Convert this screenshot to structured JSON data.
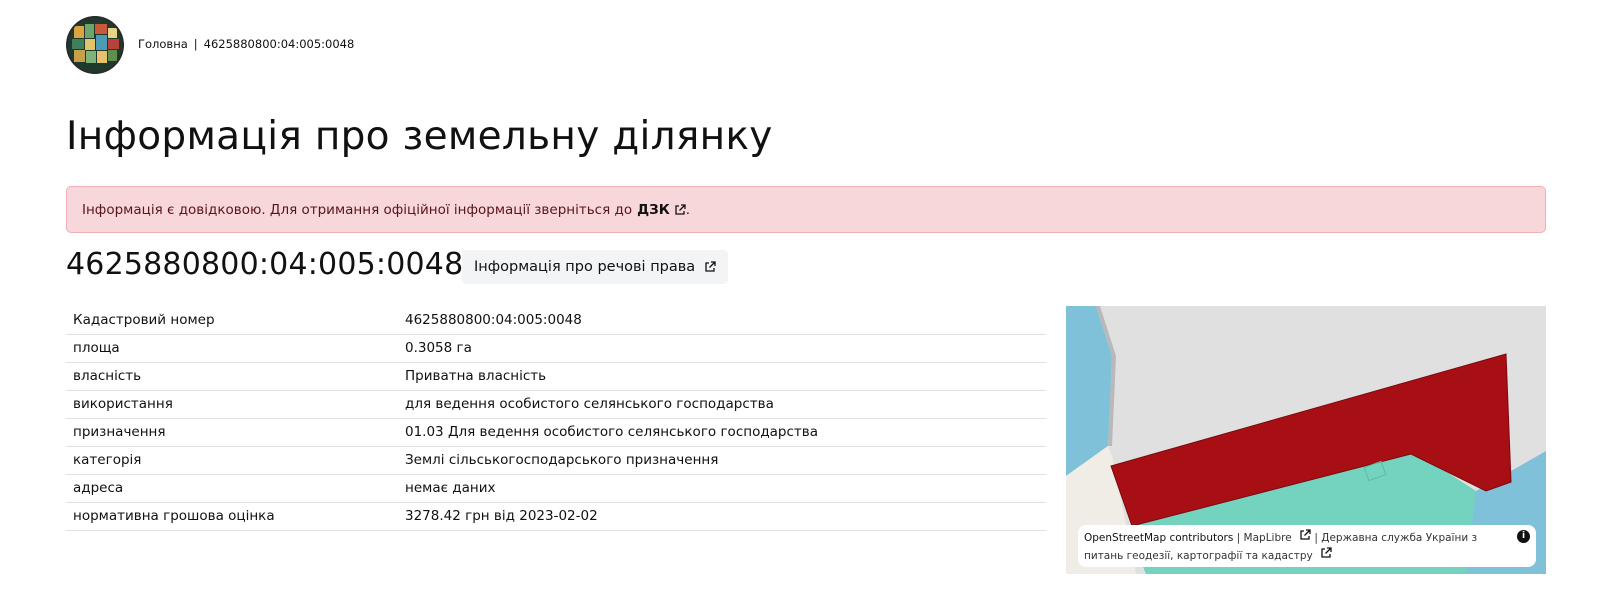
{
  "breadcrumb": {
    "home": "Головна",
    "separator": "|",
    "current": "4625880800:04:005:0048"
  },
  "page_title": "Інформація про земельну ділянку",
  "alert": {
    "text": "Інформація є довідковою. Для отримання офіційної інформації зверніться до",
    "link": "ДЗК",
    "tail": "."
  },
  "parcel": {
    "cadastral_number": "4625880800:04:005:0048",
    "rights_button": "Інформація про речові права"
  },
  "details": [
    {
      "key": "Кадастровий номер",
      "value": "4625880800:04:005:0048"
    },
    {
      "key": "площа",
      "value": "0.3058 га"
    },
    {
      "key": "власність",
      "value": "Приватна власність"
    },
    {
      "key": "використання",
      "value": "для ведення особистого селянського господарства"
    },
    {
      "key": "призначення",
      "value": "01.03 Для ведення особистого селянського господарства"
    },
    {
      "key": "категорія",
      "value": "Землі сільськогосподарського призначення"
    },
    {
      "key": "адреса",
      "value": "немає даних"
    },
    {
      "key": "нормативна грошова оцінка",
      "value": "3278.42 грн від 2023-02-02"
    }
  ],
  "map": {
    "attribution_osm": "OpenStreetMap contributors",
    "attribution_sep1": "|",
    "attribution_maplibre": "MapLibre",
    "attribution_sep2": "|",
    "attribution_dzk": "Державна служба України з питань геодезії, картографії та кадастру",
    "info_glyph": "i",
    "colors": {
      "parcel": "#a80f14",
      "water": "#7ec1d9",
      "green": "#74d3be",
      "background": "#e0e0e0"
    }
  }
}
